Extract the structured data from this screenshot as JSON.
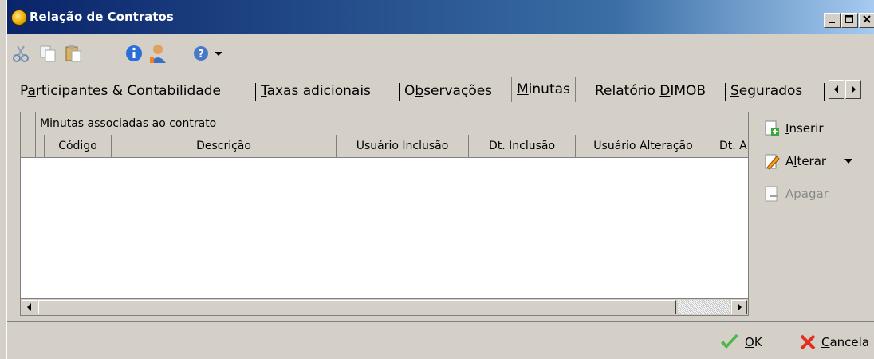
{
  "window": {
    "title": "Relação de Contratos",
    "controls": [
      "minimize",
      "maximize",
      "close"
    ]
  },
  "toolbar": {
    "items": [
      "cut-icon",
      "copy-icon",
      "paste-icon",
      "info-icon",
      "user-icon",
      "help-icon",
      "dropdown-arrow-icon"
    ]
  },
  "tabs": [
    {
      "label": "Participantes & Contabilidade",
      "pre": "P",
      "u": "a",
      "post": "rticipantes & Contabilidade"
    },
    {
      "label": "Taxas adicionais",
      "pre": "",
      "u": "T",
      "post": "axas adicionais"
    },
    {
      "label": "Observações",
      "pre": "O",
      "u": "b",
      "post": "servações"
    },
    {
      "label": "Minutas",
      "pre": "",
      "u": "M",
      "post": "inutas",
      "active": true
    },
    {
      "label": "Relatório DIMOB",
      "pre": "Relatório ",
      "u": "D",
      "post": "IMOB"
    },
    {
      "label": "Segurados",
      "pre": "",
      "u": "S",
      "post": "egurados"
    }
  ],
  "grid": {
    "group_label": "Minutas associadas ao contrato",
    "columns": [
      "Código",
      "Descrição",
      "Usuário Inclusão",
      "Dt. Inclusão",
      "Usuário Alteração",
      "Dt. A"
    ],
    "rows": []
  },
  "actions": {
    "insert": {
      "pre": "",
      "u": "I",
      "post": "nserir"
    },
    "edit": {
      "pre": "A",
      "u": "l",
      "post": "terar"
    },
    "delete": {
      "pre": "A",
      "u": "p",
      "post": "agar"
    }
  },
  "footer": {
    "ok": {
      "pre": "",
      "u": "O",
      "post": "K"
    },
    "cancel": {
      "pre": "",
      "u": "C",
      "post": "ancela"
    }
  },
  "colors": {
    "title_bar_start": "#0a246a",
    "title_bar_end": "#a6caf0",
    "window_bg": "#d4d0c8"
  }
}
